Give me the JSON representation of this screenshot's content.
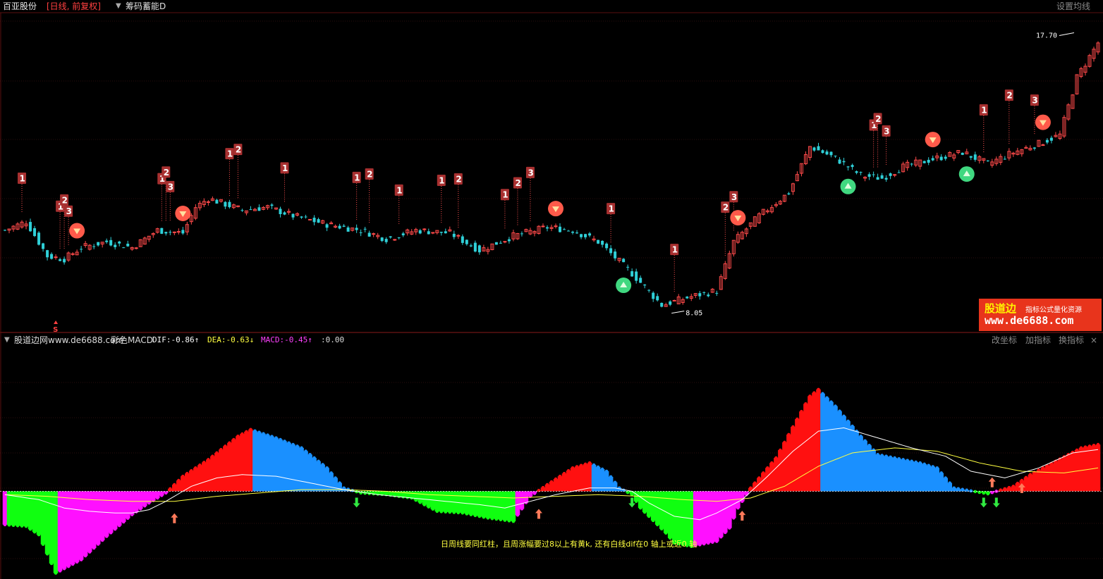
{
  "header": {
    "stock_name": "百亚股份",
    "period": "[日线, 前复权]",
    "indicator": "筹码蓄能D",
    "ma_settings": "设置均线"
  },
  "price": {
    "high_label": "17.70",
    "low_label": "8.05",
    "sell_marker": "S"
  },
  "macd_header": {
    "source": "股道边网www.de6688.com",
    "title": "彩色MACD",
    "dif": "DIF:-0.86↑",
    "dea": "DEA:-0.63↓",
    "macd": "MACD:-0.45↑",
    "zero": ":0.00",
    "btn_axis": "改坐标",
    "btn_add": "加指标",
    "btn_change": "换指标",
    "btn_close": "×"
  },
  "watermark": {
    "line1": "股道边",
    "line1b": "指标公式量化资源",
    "line2": "www.de6688.com"
  },
  "note": "日周线要同红柱，且周涨幅要过8以上有黄k, 还有白线dif在0 轴上或近0 轴",
  "colors": {
    "up": "#ff4a4a",
    "down": "#2fd0d8",
    "hist_red": "#ff1010",
    "hist_blue": "#1a90ff",
    "hist_green": "#10ff10",
    "hist_magenta": "#ff10ff",
    "dif_line": "#ffffff",
    "dea_line": "#ffff40",
    "label_box": "#a83030"
  },
  "chart_data": {
    "type": "candlestick",
    "close_anchors": [
      [
        0,
        10.9
      ],
      [
        5,
        11.2
      ],
      [
        10,
        10.0
      ],
      [
        14,
        9.9
      ],
      [
        18,
        10.3
      ],
      [
        24,
        10.5
      ],
      [
        30,
        10.3
      ],
      [
        36,
        10.9
      ],
      [
        42,
        10.8
      ],
      [
        45,
        11.7
      ],
      [
        48,
        12.0
      ],
      [
        56,
        11.6
      ],
      [
        62,
        11.7
      ],
      [
        68,
        11.4
      ],
      [
        76,
        11.1
      ],
      [
        84,
        10.9
      ],
      [
        90,
        10.6
      ],
      [
        97,
        10.9
      ],
      [
        105,
        10.8
      ],
      [
        112,
        10.2
      ],
      [
        120,
        10.7
      ],
      [
        128,
        11.0
      ],
      [
        134,
        10.9
      ],
      [
        140,
        10.5
      ],
      [
        148,
        9.4
      ],
      [
        155,
        8.3
      ],
      [
        162,
        8.6
      ],
      [
        168,
        8.8
      ],
      [
        172,
        10.5
      ],
      [
        178,
        11.4
      ],
      [
        185,
        12.2
      ],
      [
        190,
        13.8
      ],
      [
        196,
        13.4
      ],
      [
        202,
        12.8
      ],
      [
        207,
        12.7
      ],
      [
        212,
        13.1
      ],
      [
        220,
        13.4
      ],
      [
        226,
        13.6
      ],
      [
        232,
        13.2
      ],
      [
        238,
        13.6
      ],
      [
        244,
        13.9
      ],
      [
        249,
        14.2
      ],
      [
        253,
        16.2
      ],
      [
        258,
        17.4
      ]
    ],
    "price_range": [
      7.6,
      18.2
    ],
    "signals": [
      {
        "i": 4,
        "label": "1",
        "pos": "above"
      },
      {
        "i": 13,
        "label": "1",
        "pos": "above"
      },
      {
        "i": 14,
        "label": "2",
        "pos": "above"
      },
      {
        "i": 15,
        "label": "3",
        "pos": "above"
      },
      {
        "i": 37,
        "label": "1",
        "pos": "above"
      },
      {
        "i": 38,
        "label": "2",
        "pos": "above"
      },
      {
        "i": 39,
        "label": "3",
        "pos": "above"
      },
      {
        "i": 53,
        "label": "1",
        "pos": "above"
      },
      {
        "i": 55,
        "label": "2",
        "pos": "above"
      },
      {
        "i": 66,
        "label": "1",
        "pos": "above"
      },
      {
        "i": 83,
        "label": "1",
        "pos": "above"
      },
      {
        "i": 86,
        "label": "2",
        "pos": "above"
      },
      {
        "i": 93,
        "label": "1",
        "pos": "above"
      },
      {
        "i": 103,
        "label": "1",
        "pos": "above"
      },
      {
        "i": 107,
        "label": "2",
        "pos": "above"
      },
      {
        "i": 118,
        "label": "1",
        "pos": "above"
      },
      {
        "i": 121,
        "label": "2",
        "pos": "above"
      },
      {
        "i": 124,
        "label": "3",
        "pos": "above"
      },
      {
        "i": 143,
        "label": "1",
        "pos": "above"
      },
      {
        "i": 158,
        "label": "1",
        "pos": "above"
      },
      {
        "i": 170,
        "label": "2",
        "pos": "above"
      },
      {
        "i": 172,
        "label": "3",
        "pos": "above"
      },
      {
        "i": 205,
        "label": "1",
        "pos": "above"
      },
      {
        "i": 206,
        "label": "2",
        "pos": "above"
      },
      {
        "i": 208,
        "label": "3",
        "pos": "above"
      },
      {
        "i": 231,
        "label": "1",
        "pos": "above"
      },
      {
        "i": 237,
        "label": "2",
        "pos": "above"
      },
      {
        "i": 243,
        "label": "3",
        "pos": "above"
      }
    ],
    "sell_balls": [
      17,
      42,
      130,
      173,
      219,
      245
    ],
    "buy_balls": [
      146,
      199,
      227
    ],
    "macd": {
      "hist_anchors": [
        [
          0,
          -2.0
        ],
        [
          5,
          -2.1
        ],
        [
          8,
          -2.6
        ],
        [
          12,
          -4.9
        ],
        [
          18,
          -4.1
        ],
        [
          24,
          -2.7
        ],
        [
          30,
          -1.4
        ],
        [
          34,
          -0.7
        ],
        [
          38,
          -0.1
        ],
        [
          42,
          0.9
        ],
        [
          48,
          1.9
        ],
        [
          55,
          3.3
        ],
        [
          58,
          3.7
        ],
        [
          64,
          3.2
        ],
        [
          70,
          2.6
        ],
        [
          76,
          1.4
        ],
        [
          80,
          0.2
        ],
        [
          84,
          -0.1
        ],
        [
          90,
          -0.2
        ],
        [
          96,
          -0.4
        ],
        [
          102,
          -1.2
        ],
        [
          108,
          -1.3
        ],
        [
          114,
          -1.6
        ],
        [
          120,
          -1.8
        ],
        [
          124,
          -0.3
        ],
        [
          128,
          0.4
        ],
        [
          134,
          1.4
        ],
        [
          138,
          1.7
        ],
        [
          142,
          1.2
        ],
        [
          145,
          0.2
        ],
        [
          148,
          -0.2
        ],
        [
          150,
          -1.0
        ],
        [
          156,
          -2.5
        ],
        [
          158,
          -3.1
        ],
        [
          162,
          -3.3
        ],
        [
          168,
          -3.0
        ],
        [
          171,
          -2.2
        ],
        [
          173,
          -1.0
        ],
        [
          176,
          0.2
        ],
        [
          182,
          2.0
        ],
        [
          185,
          3.4
        ],
        [
          190,
          5.7
        ],
        [
          192,
          6.1
        ],
        [
          196,
          5.1
        ],
        [
          202,
          3.3
        ],
        [
          206,
          2.2
        ],
        [
          210,
          2.0
        ],
        [
          216,
          1.7
        ],
        [
          220,
          1.4
        ],
        [
          224,
          0.2
        ],
        [
          232,
          -0.15
        ],
        [
          238,
          0.3
        ],
        [
          242,
          1.0
        ],
        [
          248,
          1.8
        ],
        [
          254,
          2.6
        ],
        [
          258,
          2.8
        ]
      ],
      "dif_anchors": [
        [
          0,
          -0.2
        ],
        [
          8,
          -0.5
        ],
        [
          14,
          -1.0
        ],
        [
          20,
          -1.2
        ],
        [
          26,
          -1.3
        ],
        [
          30,
          -1.3
        ],
        [
          34,
          -1.1
        ],
        [
          38,
          -0.6
        ],
        [
          44,
          0.3
        ],
        [
          50,
          0.8
        ],
        [
          56,
          1.0
        ],
        [
          64,
          0.9
        ],
        [
          72,
          0.5
        ],
        [
          80,
          0.1
        ],
        [
          88,
          -0.2
        ],
        [
          96,
          -0.4
        ],
        [
          104,
          -0.6
        ],
        [
          112,
          -0.8
        ],
        [
          118,
          -1.0
        ],
        [
          124,
          -0.6
        ],
        [
          130,
          -0.2
        ],
        [
          138,
          0.2
        ],
        [
          144,
          0.2
        ],
        [
          148,
          0.0
        ],
        [
          152,
          -0.7
        ],
        [
          158,
          -1.5
        ],
        [
          164,
          -1.7
        ],
        [
          168,
          -1.3
        ],
        [
          174,
          -0.5
        ],
        [
          180,
          0.9
        ],
        [
          186,
          2.4
        ],
        [
          192,
          3.6
        ],
        [
          198,
          3.8
        ],
        [
          206,
          3.2
        ],
        [
          214,
          2.6
        ],
        [
          222,
          2.1
        ],
        [
          228,
          1.2
        ],
        [
          236,
          0.8
        ],
        [
          244,
          1.4
        ],
        [
          252,
          2.3
        ],
        [
          258,
          2.5
        ]
      ],
      "dea_anchors": [
        [
          0,
          -0.2
        ],
        [
          10,
          -0.3
        ],
        [
          20,
          -0.5
        ],
        [
          30,
          -0.6
        ],
        [
          40,
          -0.6
        ],
        [
          50,
          -0.3
        ],
        [
          60,
          -0.1
        ],
        [
          70,
          0.1
        ],
        [
          80,
          0.1
        ],
        [
          90,
          0.0
        ],
        [
          100,
          -0.2
        ],
        [
          110,
          -0.3
        ],
        [
          120,
          -0.4
        ],
        [
          130,
          -0.3
        ],
        [
          140,
          -0.2
        ],
        [
          150,
          -0.3
        ],
        [
          160,
          -0.5
        ],
        [
          168,
          -0.6
        ],
        [
          176,
          -0.4
        ],
        [
          184,
          0.3
        ],
        [
          192,
          1.5
        ],
        [
          200,
          2.3
        ],
        [
          210,
          2.6
        ],
        [
          220,
          2.4
        ],
        [
          230,
          1.7
        ],
        [
          240,
          1.2
        ],
        [
          250,
          1.1
        ],
        [
          258,
          1.4
        ]
      ],
      "range": [
        -5.0,
        8.5
      ],
      "arrows_up": [
        40,
        126,
        174,
        233,
        240
      ],
      "arrows_down": [
        83,
        148,
        231,
        234
      ]
    }
  }
}
